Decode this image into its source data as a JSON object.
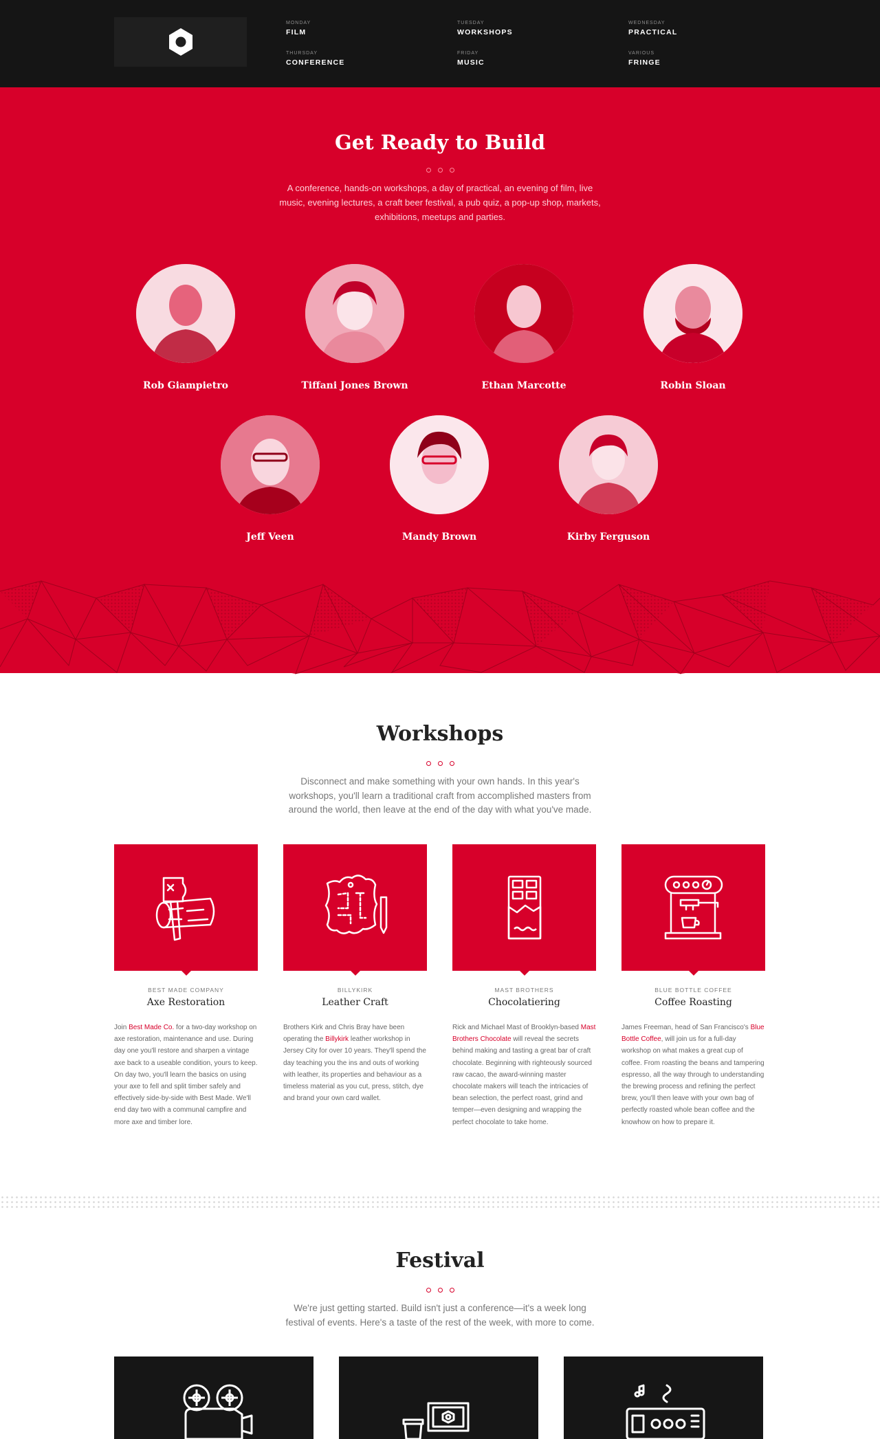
{
  "nav": {
    "items": [
      {
        "day": "MONDAY",
        "label": "FILM"
      },
      {
        "day": "TUESDAY",
        "label": "WORKSHOPS"
      },
      {
        "day": "WEDNESDAY",
        "label": "PRACTICAL"
      },
      {
        "day": "THURSDAY",
        "label": "CONFERENCE"
      },
      {
        "day": "FRIDAY",
        "label": "MUSIC"
      },
      {
        "day": "VARIOUS",
        "label": "FRINGE"
      }
    ]
  },
  "hero": {
    "title": "Get Ready to Build",
    "text": "A conference, hands-on workshops, a day of practical, an evening of film, live music, evening lectures, a craft beer festival, a pub quiz, a pop-up shop, markets, exhibitions, meetups and parties.",
    "speakers": [
      "Rob Giampietro",
      "Tiffani Jones Brown",
      "Ethan Marcotte",
      "Robin Sloan",
      "Jeff Veen",
      "Mandy Brown",
      "Kirby Ferguson"
    ]
  },
  "workshops": {
    "title": "Workshops",
    "text": "Disconnect and make something with your own hands. In this year's workshops, you'll learn a traditional craft from accomplished masters from around the world, then leave at the end of the day with what you've made.",
    "cards": [
      {
        "icon": "axe-log-icon",
        "company": "BEST MADE COMPANY",
        "name": "Axe Restoration",
        "pre": "Join ",
        "link": "Best Made Co.",
        "post": " for a two-day workshop on axe restoration, maintenance and use. During day one you'll restore and sharpen a vintage axe back to a useable condition, yours to keep. On day two, you'll learn the basics on using your axe to fell and split timber safely and effectively side-by-side with Best Made. We'll end day two with a communal campfire and more axe and timber lore."
      },
      {
        "icon": "leather-hide-icon",
        "company": "BILLYKIRK",
        "name": "Leather Craft",
        "pre": "Brothers Kirk and Chris Bray have been operating the ",
        "link": "Billykirk",
        "post": " leather workshop in Jersey City for over 10 years. They'll spend the day teaching you the ins and outs of working with leather, its properties and behaviour as a timeless material as you cut, press, stitch, dye and brand your own card wallet."
      },
      {
        "icon": "chocolate-bar-icon",
        "company": "MAST BROTHERS",
        "name": "Chocolatiering",
        "pre": "Rick and Michael Mast of Brooklyn-based ",
        "link": "Mast Brothers Chocolate",
        "post": " will reveal the secrets behind making and tasting a great bar of craft chocolate. Beginning with righteously sourced raw cacao, the award-winning master chocolate makers will teach the intricacies of bean selection, the perfect roast, grind and temper—even designing and wrapping the perfect chocolate to take home."
      },
      {
        "icon": "espresso-machine-icon",
        "company": "BLUE BOTTLE COFFEE",
        "name": "Coffee Roasting",
        "pre": "James Freeman, head of San Francisco's ",
        "link": "Blue Bottle Coffee",
        "post": ", will join us for a full-day workshop on what makes a great cup of coffee. From roasting the beans and tampering espresso, all the way through to understanding the brewing process and refining the perfect brew, you'll then leave with your own bag of perfectly roasted whole bean coffee and the knowhow on how to prepare it."
      }
    ]
  },
  "festival": {
    "title": "Festival",
    "text": "We're just getting started. Build isn't just a conference—it's a week long festival of events. Here's a taste of the rest of the week, with more to come.",
    "cards": [
      {
        "icon": "film-projector-icon"
      },
      {
        "icon": "laptop-coffee-icon"
      },
      {
        "icon": "radio-music-icon"
      }
    ]
  },
  "colors": {
    "brand_red": "#d7002a",
    "dark": "#151515"
  }
}
